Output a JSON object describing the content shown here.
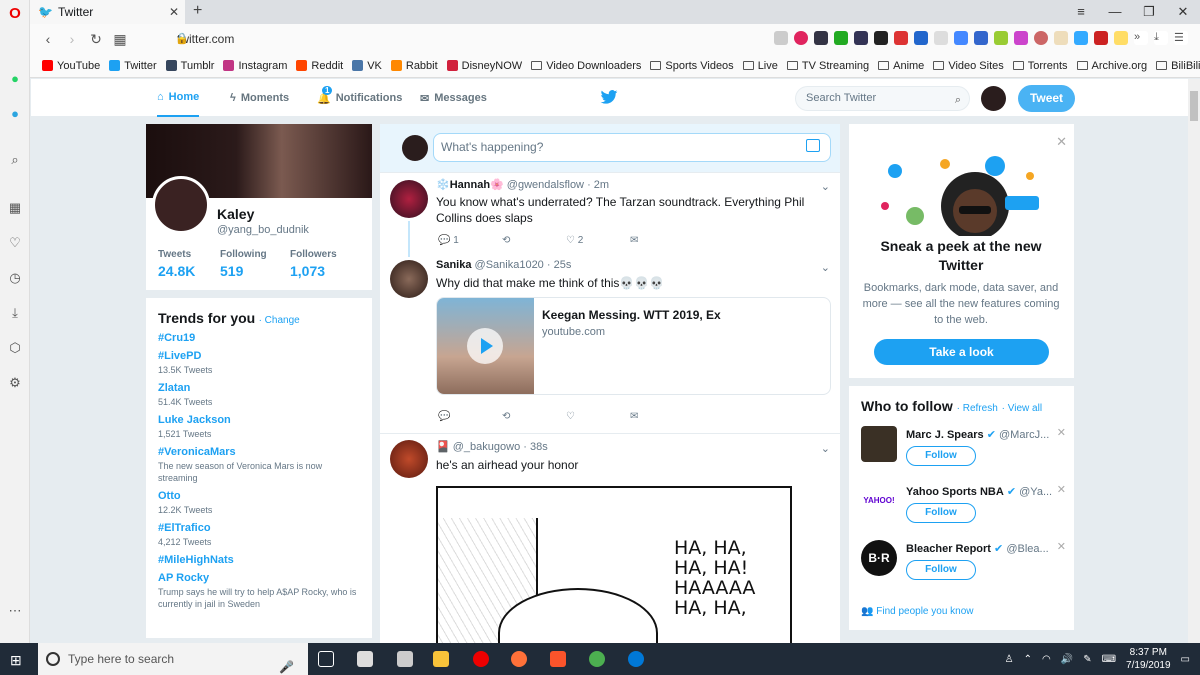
{
  "browser": {
    "tab_title": "Twitter",
    "url": "twitter.com",
    "bookmarks": [
      "YouTube",
      "Twitter",
      "Tumblr",
      "Instagram",
      "Reddit",
      "VK",
      "Rabbit",
      "DisneyNOW",
      "Video Downloaders",
      "Sports Videos",
      "Live",
      "TV Streaming",
      "Anime",
      "Video Sites",
      "Torrents",
      "Archive.org",
      "BiliBili"
    ],
    "bookmark_colors": [
      "#ff0000",
      "#1da1f2",
      "#36465d",
      "#c13584",
      "#ff4500",
      "#4a76a8",
      "#ff8800",
      "#d1213d",
      "folder",
      "folder",
      "folder",
      "folder",
      "folder",
      "folder",
      "folder",
      "folder",
      "folder"
    ]
  },
  "nav": {
    "home": "Home",
    "moments": "Moments",
    "notifications": "Notifications",
    "notif_badge": "1",
    "messages": "Messages",
    "search_placeholder": "Search Twitter",
    "tweet_button": "Tweet"
  },
  "profile": {
    "name": "Kaley",
    "handle": "@yang_bo_dudnik",
    "tweets_label": "Tweets",
    "tweets": "24.8K",
    "following_label": "Following",
    "following": "519",
    "followers_label": "Followers",
    "followers": "1,073"
  },
  "trends": {
    "title": "Trends for you",
    "change": "· Change",
    "items": [
      {
        "name": "#Cru19",
        "count": ""
      },
      {
        "name": "#LivePD",
        "count": "13.5K Tweets"
      },
      {
        "name": "Zlatan",
        "count": "51.4K Tweets"
      },
      {
        "name": "Luke Jackson",
        "count": "1,521 Tweets"
      },
      {
        "name": "#VeronicaMars",
        "count": "The new season of Veronica Mars is now streaming"
      },
      {
        "name": "Otto",
        "count": "12.2K Tweets"
      },
      {
        "name": "#ElTrafico",
        "count": "4,212 Tweets"
      },
      {
        "name": "#MileHighNats",
        "count": ""
      },
      {
        "name": "AP Rocky",
        "count": "Trump says he will try to help A$AP Rocky, who is currently in jail in Sweden"
      }
    ]
  },
  "compose": {
    "placeholder": "What's happening?"
  },
  "tweets": [
    {
      "name": "❄️Hannah🌸",
      "handle": "@gwendalsflow",
      "time": "· 2m",
      "text": "You know what's underrated? The Tarzan soundtrack. Everything Phil Collins does slaps",
      "replies": "1",
      "retweets": "",
      "likes": "2"
    },
    {
      "name": "Sanika",
      "handle": "@Sanika1020",
      "time": "· 25s",
      "text": "Why did that make me think of this💀💀💀",
      "card_title": "Keegan Messing. WTT 2019, Ex",
      "card_source": "youtube.com"
    },
    {
      "name": "🎴",
      "handle": "@_bakugowo",
      "time": "· 38s",
      "text": "he's an airhead your honor",
      "image_text": "HA, HA,\nHA, HA!\nHAAAAA\nHA, HA,"
    }
  ],
  "promo": {
    "title": "Sneak a peek at the new Twitter",
    "body": "Bookmarks, dark mode, data saver, and more — see all the new features coming to the web.",
    "button": "Take a look"
  },
  "who_to_follow": {
    "title": "Who to follow",
    "refresh": "· Refresh",
    "view_all": "· View all",
    "users": [
      {
        "name": "Marc J. Spears",
        "handle": "@MarcJ...",
        "button": "Follow"
      },
      {
        "name": "Yahoo Sports NBA",
        "handle": "@Ya...",
        "button": "Follow"
      },
      {
        "name": "Bleacher Report",
        "handle": "@Blea...",
        "button": "Follow"
      }
    ],
    "find_people": "Find people you know"
  },
  "taskbar": {
    "search_placeholder": "Type here to search",
    "time": "8:37 PM",
    "date": "7/19/2019"
  },
  "colors": {
    "accent": "#1da1f2",
    "background": "#e6ecf0"
  }
}
